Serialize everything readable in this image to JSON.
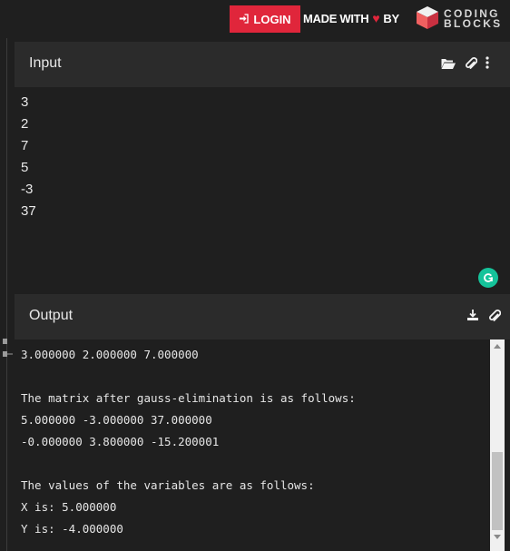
{
  "header": {
    "login_label": "LOGIN",
    "made_with": "MADE WITH",
    "by": "BY",
    "logo_line1": "CODING",
    "logo_line2": "BLOCKS"
  },
  "input_panel": {
    "title": "Input",
    "lines": [
      "3",
      "2",
      "7",
      "5",
      "-3",
      "37"
    ]
  },
  "output_panel": {
    "title": "Output",
    "lines": [
      "3.000000 2.000000 7.000000",
      "",
      "The matrix after gauss-elimination is as follows:",
      "5.000000 -3.000000 37.000000",
      "-0.000000 3.800000 -15.200001",
      "",
      "The values of the variables are as follows:",
      "X is: 5.000000",
      "Y is: -4.000000"
    ]
  },
  "colors": {
    "accent_red": "#e0263b",
    "grammarly_green": "#15c39a",
    "background": "#1f1f1f",
    "panel_header": "#2b2b2b"
  },
  "icons": {
    "input_header": [
      "folder-open-icon",
      "paperclip-icon",
      "more-vert-icon"
    ],
    "output_header": [
      "download-icon",
      "paperclip-icon"
    ]
  }
}
